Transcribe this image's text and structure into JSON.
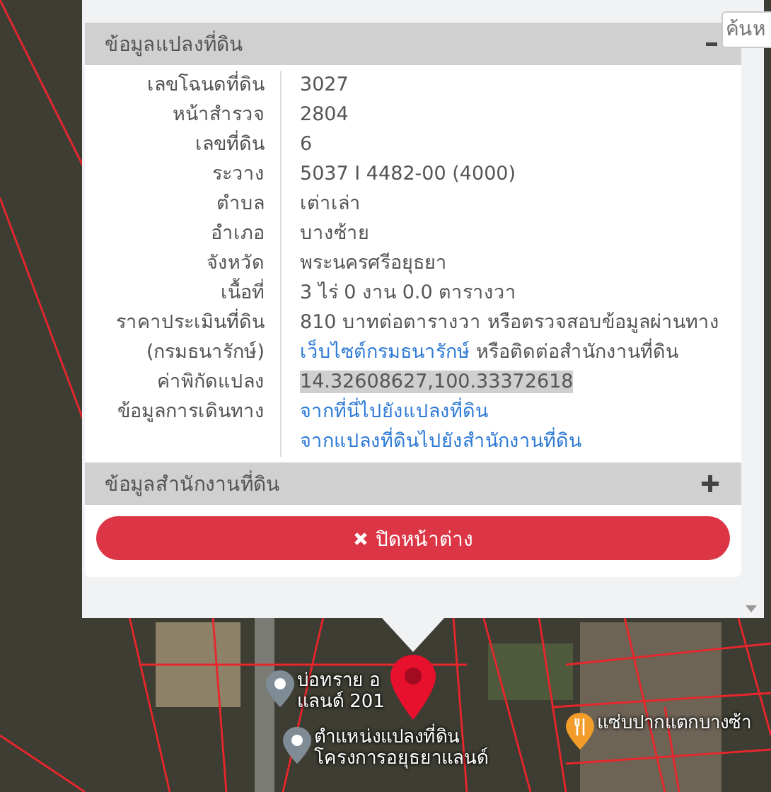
{
  "search": {
    "placeholder": "ค้นห"
  },
  "popup": {
    "sections": [
      {
        "title": "ข้อมูลแปลงที่ดิน",
        "expanded": true,
        "rows": [
          {
            "label": "เลขโฉนดที่ดิน",
            "kind": "text",
            "parts": [
              {
                "kind": "text",
                "text": "3027"
              }
            ]
          },
          {
            "label": "หน้าสำรวจ",
            "kind": "text",
            "parts": [
              {
                "kind": "text",
                "text": "2804"
              }
            ]
          },
          {
            "label": "เลขที่ดิน",
            "kind": "text",
            "parts": [
              {
                "kind": "text",
                "text": "6"
              }
            ]
          },
          {
            "label": "ระวาง",
            "kind": "text",
            "parts": [
              {
                "kind": "text",
                "text": "5037 I 4482-00 (4000)"
              }
            ]
          },
          {
            "label": "ตำบล",
            "kind": "text",
            "parts": [
              {
                "kind": "text",
                "text": "เต่าเล่า"
              }
            ]
          },
          {
            "label": "อำเภอ",
            "kind": "text",
            "parts": [
              {
                "kind": "text",
                "text": "บางซ้าย"
              }
            ]
          },
          {
            "label": "จังหวัด",
            "kind": "text",
            "parts": [
              {
                "kind": "text",
                "text": "พระนครศรีอยุธยา"
              }
            ]
          },
          {
            "label": "เนื้อที่",
            "kind": "text",
            "parts": [
              {
                "kind": "text",
                "text": "3 ไร่ 0 งาน 0.0 ตารางวา"
              }
            ]
          },
          {
            "label": "ราคาประเมินที่ดิน\n(กรมธนารักษ์)",
            "kind": "text",
            "parts": [
              {
                "kind": "text",
                "text": "810 บาทต่อตารางวา หรือตรวจสอบข้อมูลผ่านทาง\n"
              },
              {
                "kind": "link",
                "text": "เว็บไซต์กรมธนารักษ์"
              },
              {
                "kind": "text",
                "text": " หรือติดต่อสำนักงานที่ดิน"
              }
            ]
          },
          {
            "label": "ค่าพิกัดแปลง",
            "kind": "text",
            "parts": [
              {
                "kind": "highlight",
                "text": "14.32608627,100.33372618"
              }
            ]
          },
          {
            "label": "ข้อมูลการเดินทาง",
            "kind": "links",
            "parts": [
              {
                "kind": "link",
                "text": "จากที่นี่ไปยังแปลงที่ดิน"
              },
              {
                "kind": "link",
                "text": "จากแปลงที่ดินไปยังสำนักงานที่ดิน"
              }
            ]
          }
        ]
      },
      {
        "title": "ข้อมูลสำนักงานที่ดิน",
        "expanded": false
      }
    ],
    "close_button": "ปิดหน้าต่าง"
  },
  "map": {
    "markers": [
      {
        "kind": "place",
        "lines": [
          "บ่อทราย อ",
          "แลนด์ 201"
        ]
      },
      {
        "kind": "place",
        "lines": [
          "ตำแหน่งแปลงที่ดิน",
          "โครงการอยุธยาแลนด์"
        ]
      },
      {
        "kind": "restaurant",
        "lines": [
          "แซ่บปากแตกบางซ้า"
        ]
      }
    ]
  }
}
